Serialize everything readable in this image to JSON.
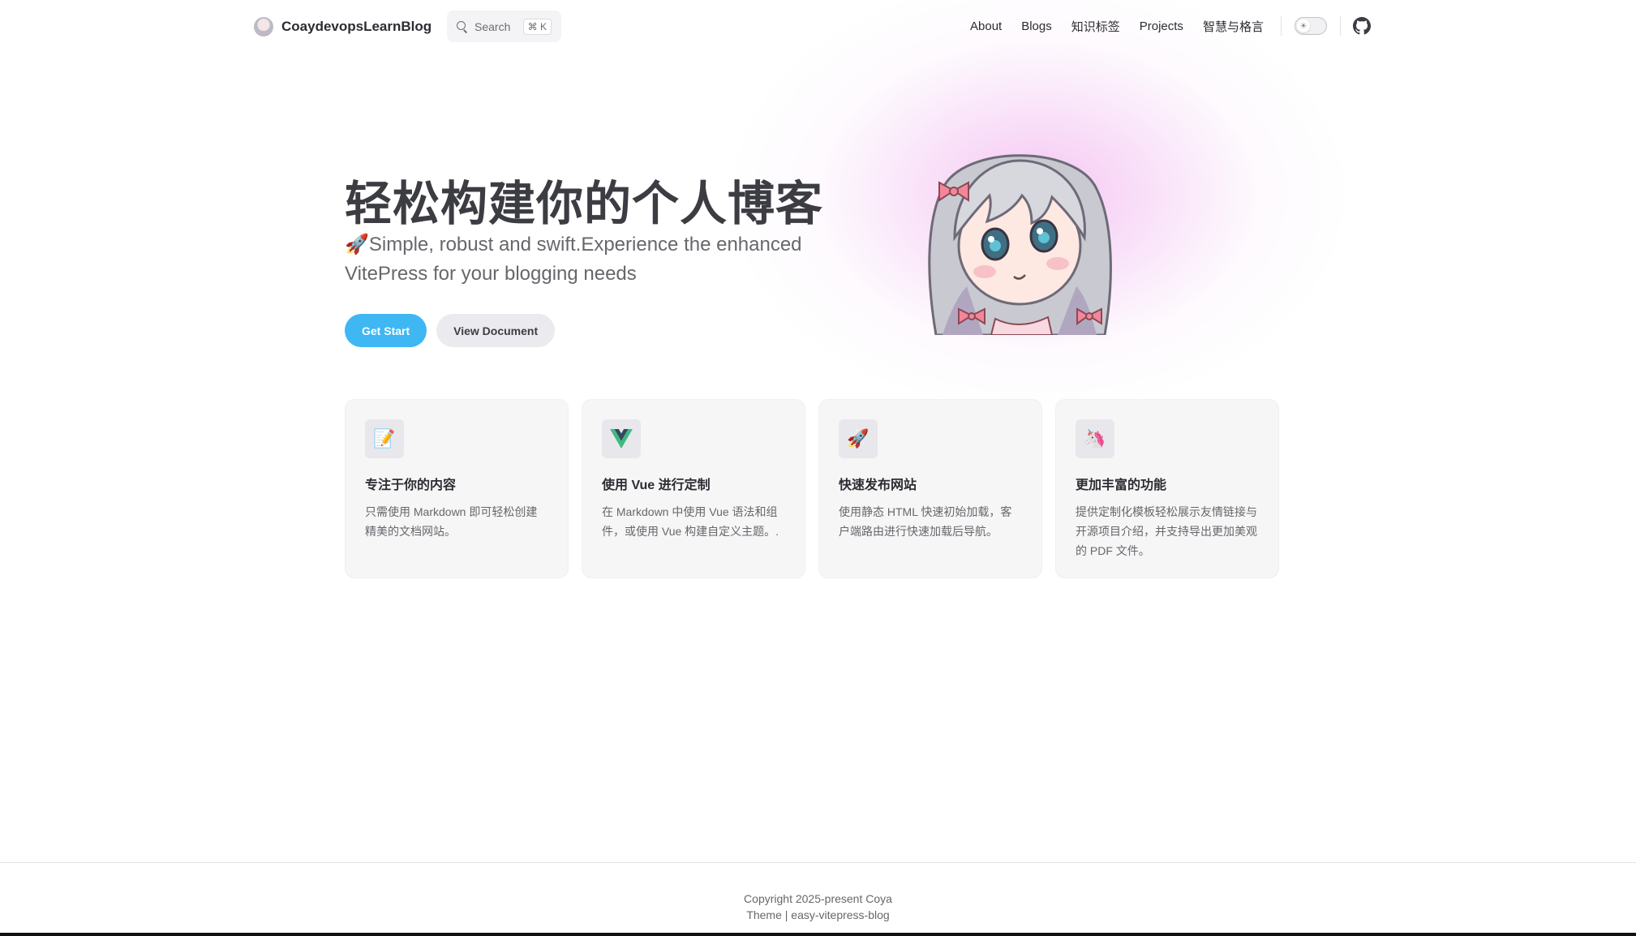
{
  "nav": {
    "title": "CoaydevopsLearnBlog",
    "search": {
      "placeholder": "Search",
      "shortcut": "⌘ K"
    },
    "links": [
      "About",
      "Blogs",
      "知识标签",
      "Projects",
      "智慧与格言"
    ],
    "theme_toggle_icon": "sun-icon",
    "social_icon": "github-icon"
  },
  "hero": {
    "title": "轻松构建你的个人博客",
    "tagline": "🚀Simple, robust and swift.Experience the enhanced VitePress for your blogging needs",
    "actions": {
      "primary": "Get Start",
      "secondary": "View Document"
    },
    "image": "anime-girl-avatar"
  },
  "features": [
    {
      "icon": "📝",
      "title": "专注于你的内容",
      "details": "只需使用 Markdown 即可轻松创建精美的文档网站。"
    },
    {
      "icon": "vue-logo",
      "title": "使用 Vue 进行定制",
      "details": "在 Markdown 中使用 Vue 语法和组件，或使用 Vue 构建自定义主题。."
    },
    {
      "icon": "🚀",
      "title": "快速发布网站",
      "details": "使用静态 HTML 快速初始加载，客户端路由进行快速加载后导航。"
    },
    {
      "icon": "🦄",
      "title": "更加丰富的功能",
      "details": "提供定制化模板轻松展示友情链接与开源项目介绍，并支持导出更加美观的 PDF 文件。"
    }
  ],
  "footer": {
    "copyright": "Copyright 2025-present Coya",
    "theme": "Theme | easy-vitepress-blog"
  },
  "colors": {
    "brand": "#3eb7f2",
    "text": "#3c3c43",
    "muted": "#67676c",
    "glow": "#ec96e6"
  }
}
